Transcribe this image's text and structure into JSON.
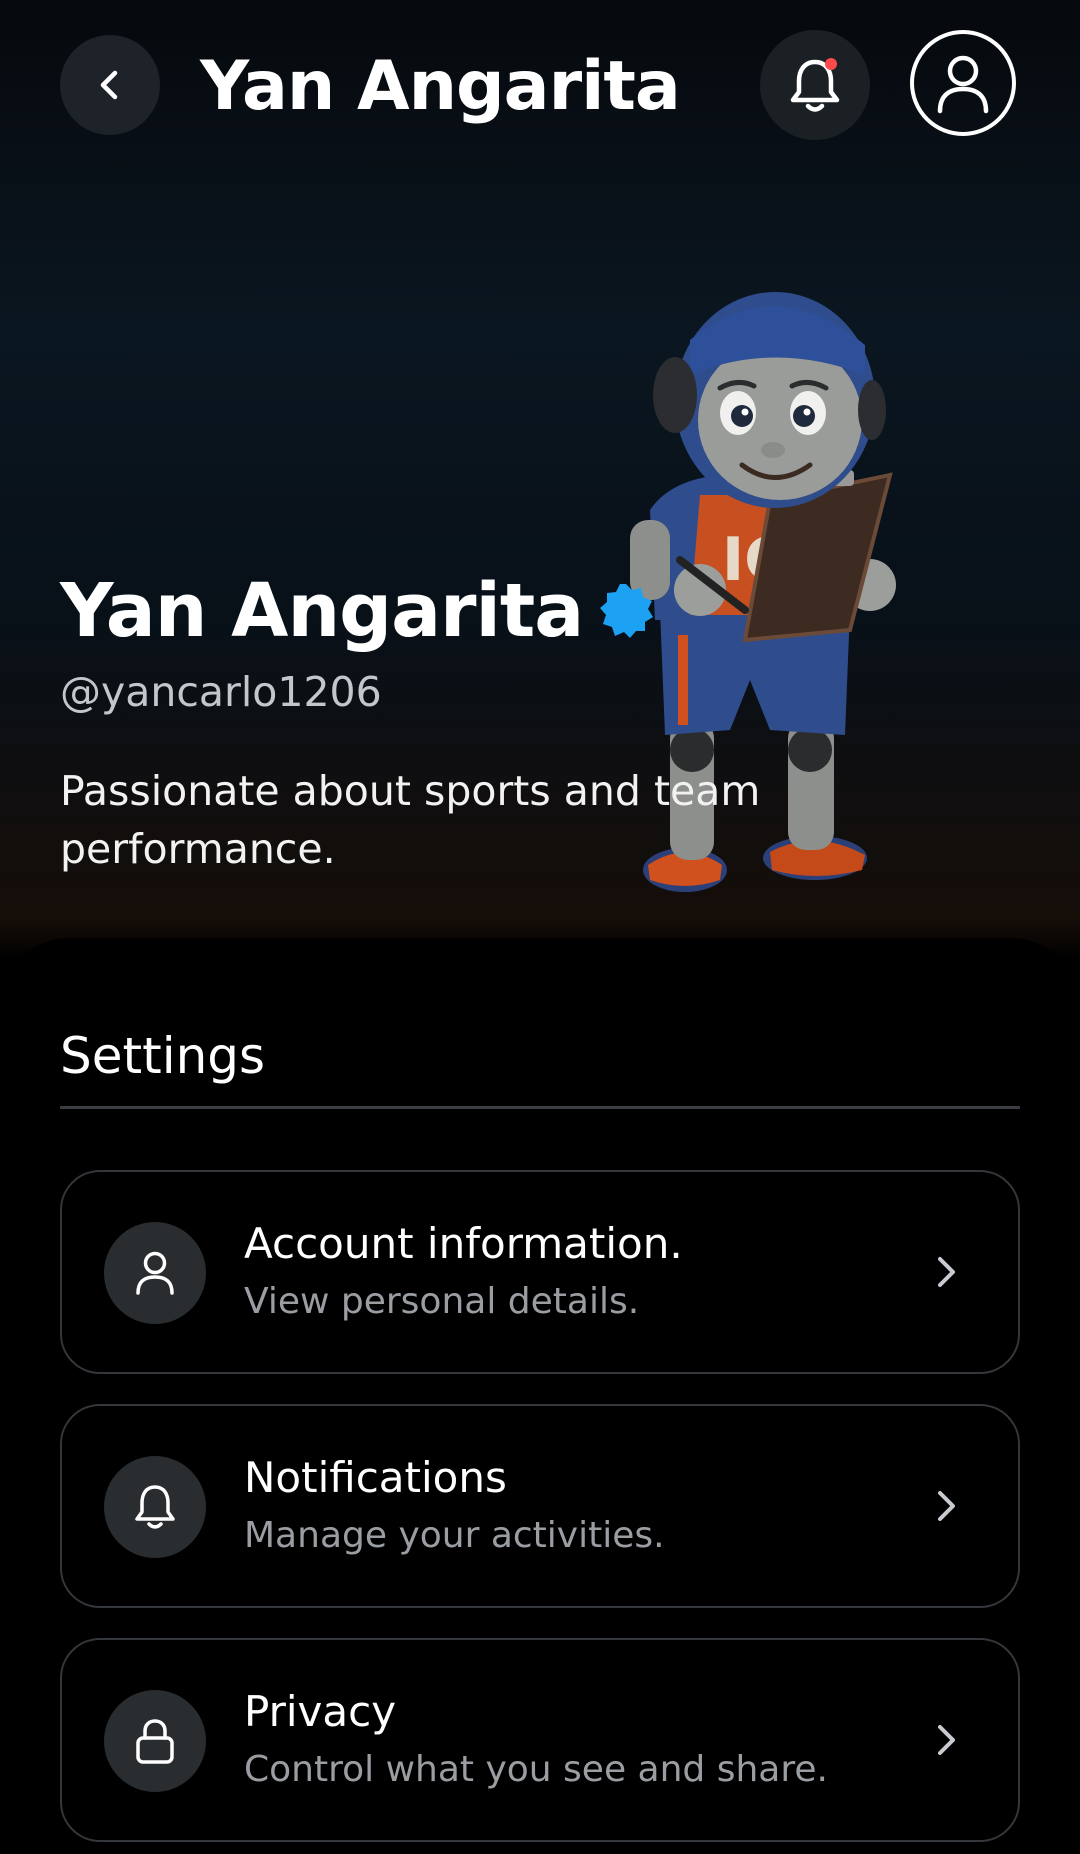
{
  "header": {
    "title": "Yan Angarita",
    "back_icon": "chevron-left-icon",
    "bell_icon": "bell-icon",
    "avatar_icon": "user-icon",
    "notification_dot_color": "#ff4a4a"
  },
  "profile": {
    "name": "Yan Angarita",
    "verified_color": "#1da1f2",
    "handle": "@yancarlo1206",
    "bio": "Passionate about sports and team performance."
  },
  "settings": {
    "title": "Settings",
    "items": [
      {
        "icon": "user-icon",
        "title": "Account information.",
        "subtitle": "View personal details."
      },
      {
        "icon": "bell-icon",
        "title": "Notifications",
        "subtitle": "Manage your activities."
      },
      {
        "icon": "lock-icon",
        "title": "Privacy",
        "subtitle": "Control what you see and share."
      }
    ]
  }
}
